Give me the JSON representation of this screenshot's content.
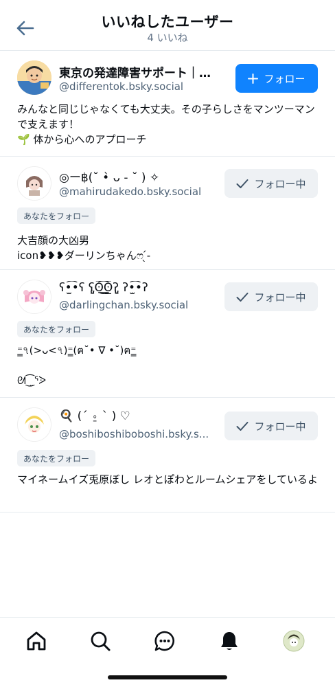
{
  "header": {
    "title": "いいねしたユーザー",
    "subtitle": "4 いいね",
    "back_icon": "arrow-left-icon"
  },
  "users": [
    {
      "name": "東京の発達障害サポート｜…",
      "handle": "@differentok.bsky.social",
      "button_label": "フォロー",
      "button_icon": "plus-icon",
      "badge": "",
      "bio": "みんなと同じじゃなくても大丈夫。その子らしさをマンツーマンで支えます！\n🌱 体から心へのアプローチ"
    },
    {
      "name": "◎ー฿(˘ •̀ ᴗ - ˘ ) ✧",
      "handle": "@mahirudakedo.bsky.social",
      "button_label": "フォロー中",
      "button_icon": "check-icon",
      "badge": "あなたをフォロー",
      "bio": "大吉顔の大凶男\nicon❥❥❥ダーリンちゃんෆ ̖́-"
    },
    {
      "name": "ʕ•̫͡•ʕ ʕ̡̢̡ʘ̅͟͜͡ʘ̲̅ʔ̢̡̢ ʔ•̫͡•ʔ",
      "handle": "@darlingchan.bsky.social",
      "button_label": "フォロー中",
      "button_icon": "check-icon",
      "badge": "あなたをフォロー",
      "bio": "⁼̳৭(>ᴗ<৭)⁼̳(ฅ˘• ∇ •˘)ฅ⁼̳\n\nᘛ⁐̤ᕐᐷ"
    },
    {
      "name": "🍳 (´ ⍛ ` ) ♡",
      "handle": "@boshiboshiboboshi.bsky.s...",
      "button_label": "フォロー中",
      "button_icon": "check-icon",
      "badge": "あなたをフォロー",
      "bio": "マイネームイズ兎原ぼし  レオとぽわとルームシェアをしているよ"
    }
  ],
  "tabbar": {
    "items": [
      "home-icon",
      "search-icon",
      "chat-icon",
      "bell-icon",
      "profile-avatar"
    ]
  },
  "colors": {
    "accent": "#1083fe",
    "secondary_bg": "#eef1f4",
    "muted_text": "#66768a",
    "divider": "#e6ebef"
  }
}
